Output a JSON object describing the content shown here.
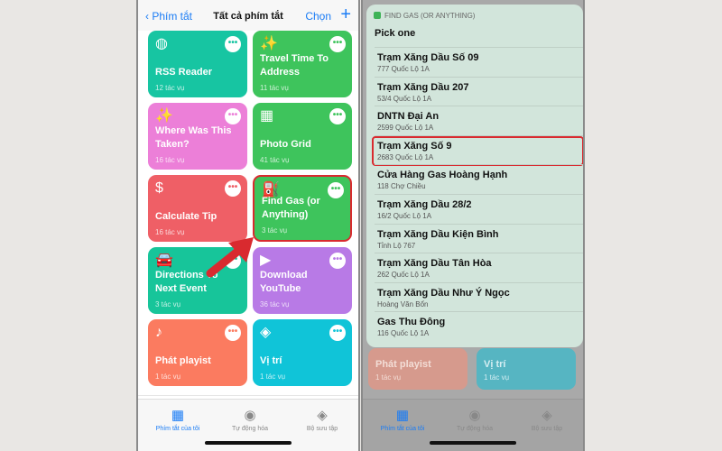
{
  "left": {
    "header": {
      "back": "‹ Phím tắt",
      "title": "Tất cả phím tắt",
      "select": "Chọn",
      "add": "+"
    },
    "cards": [
      {
        "name": "RSS Reader",
        "count": "12 tác vụ",
        "icon": "globe-icon",
        "glyph": "◍",
        "color": "#17c5a2"
      },
      {
        "name": "Travel Time To Address",
        "count": "11 tác vụ",
        "icon": "magic-wand-icon",
        "glyph": "✨",
        "color": "#3ec45c"
      },
      {
        "name": "Where Was This Taken?",
        "count": "16 tác vụ",
        "icon": "magic-wand-icon",
        "glyph": "✨",
        "color": "#ec7fd8"
      },
      {
        "name": "Photo Grid",
        "count": "41 tác vụ",
        "icon": "grid-icon",
        "glyph": "▦",
        "color": "#3ec45c"
      },
      {
        "name": "Calculate Tip",
        "count": "16 tác vụ",
        "icon": "dollar-icon",
        "glyph": "$",
        "color": "#ef5f66"
      },
      {
        "name": "Find Gas (or Anything)",
        "count": "3 tác vụ",
        "icon": "fuel-pump-icon",
        "glyph": "⛽",
        "color": "#3ec45c"
      },
      {
        "name": "Directions To Next Event",
        "count": "3 tác vụ",
        "icon": "car-icon",
        "glyph": "🚘",
        "color": "#17c59a"
      },
      {
        "name": "Download YouTube",
        "count": "36 tác vụ",
        "icon": "play-icon",
        "glyph": "▶",
        "color": "#b87ae6"
      },
      {
        "name": "Phát playist",
        "count": "1 tác vụ",
        "icon": "music-note-icon",
        "glyph": "♪",
        "color": "#fb7b60"
      },
      {
        "name": "Vị trí",
        "count": "1 tác vụ",
        "icon": "layers-icon",
        "glyph": "◈",
        "color": "#10c4d8"
      }
    ]
  },
  "tabs": [
    {
      "label": "Phím tắt của tôi",
      "icon": "grid-icon",
      "glyph": "▦",
      "active": true
    },
    {
      "label": "Tự động hóa",
      "icon": "clock-check-icon",
      "glyph": "◉"
    },
    {
      "label": "Bộ sưu tập",
      "icon": "layers-icon",
      "glyph": "◈"
    }
  ],
  "sheet": {
    "app": "FIND GAS (OR ANYTHING)",
    "prompt": "Pick one",
    "items": [
      {
        "title": "Trạm Xăng Dầu Số 09",
        "sub": "777 Quốc Lộ 1A"
      },
      {
        "title": "Trạm Xăng Dầu 207",
        "sub": "53/4 Quốc Lộ 1A"
      },
      {
        "title": "DNTN Đại An",
        "sub": "2599 Quốc Lộ 1A"
      },
      {
        "title": "Trạm Xăng Số 9",
        "sub": "2683 Quốc Lộ 1A",
        "highlighted": true
      },
      {
        "title": "Cửa Hàng Gas Hoàng Hạnh",
        "sub": "118 Chợ Chiều"
      },
      {
        "title": "Trạm Xăng Dầu 28/2",
        "sub": "16/2 Quốc Lộ 1A"
      },
      {
        "title": "Trạm Xăng Dầu Kiện Bình",
        "sub": "Tỉnh Lộ 767"
      },
      {
        "title": "Trạm Xăng Dầu Tân Hòa",
        "sub": "262 Quốc Lộ 1A"
      },
      {
        "title": "Trạm Xăng Dầu Như Ý Ngọc",
        "sub": "Hoàng Văn Bổn"
      },
      {
        "title": "Gas Thu Đông",
        "sub": "116 Quốc Lộ 1A"
      }
    ]
  },
  "more_glyph": "•••",
  "highlight_color": "#d92a2f"
}
